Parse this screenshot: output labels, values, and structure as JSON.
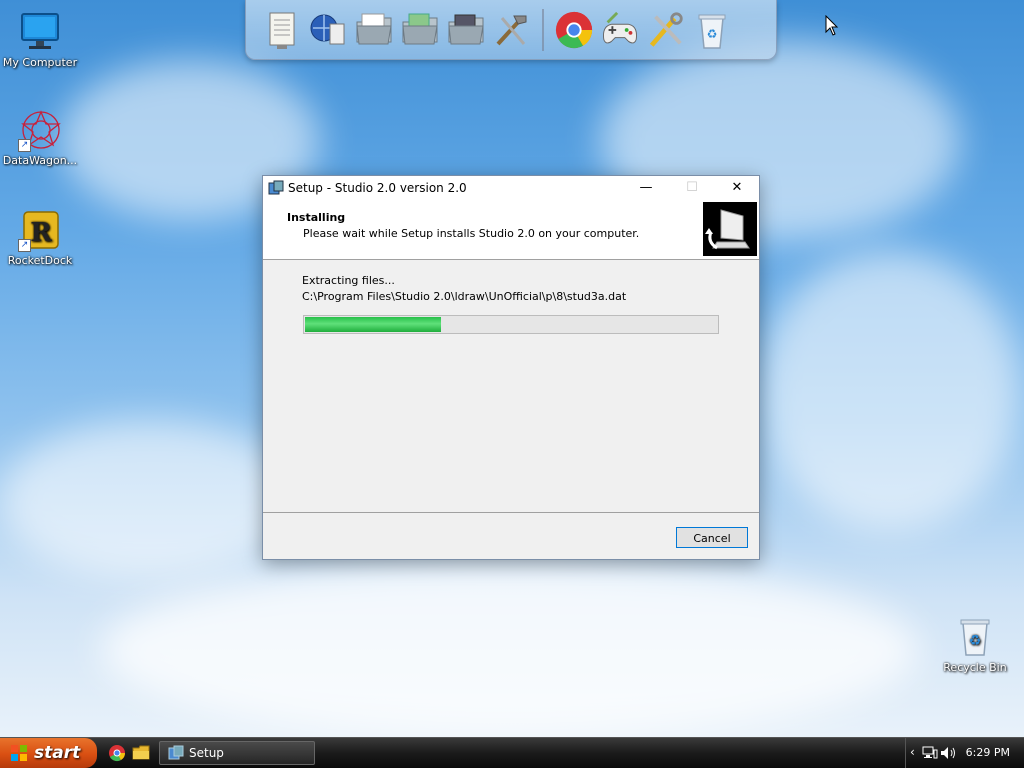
{
  "desktop": {
    "icons": [
      {
        "label": "My Computer",
        "icon": "monitor-icon"
      },
      {
        "label": "DataWagon...",
        "icon": "datawagon-icon"
      },
      {
        "label": "RocketDock",
        "icon": "rocketdock-icon"
      },
      {
        "label": "Recycle Bin",
        "icon": "recycle-bin-icon"
      }
    ]
  },
  "dock": {
    "items": [
      "notepad-icon",
      "network-globe-icon",
      "folder-icon",
      "folder-documents-icon",
      "folder-images-icon",
      "tools-icon",
      "chrome-icon",
      "gamepad-icon",
      "settings-tools-icon",
      "recycle-bin-icon"
    ]
  },
  "window": {
    "title": "Setup - Studio 2.0 version 2.0",
    "header_title": "Installing",
    "header_subtitle": "Please wait while Setup installs Studio 2.0 on your computer.",
    "status": "Extracting files...",
    "current_file": "C:\\Program Files\\Studio 2.0\\ldraw\\UnOfficial\\p\\8\\stud3a.dat",
    "progress_fraction": 0.33,
    "cancel_label": "Cancel"
  },
  "taskbar": {
    "start_label": "start",
    "task_label": "Setup",
    "clock": "6:29 PM"
  },
  "colors": {
    "progress_green": "#28c04a",
    "start_orange": "#d94f12",
    "focus_blue": "#0078d7"
  }
}
